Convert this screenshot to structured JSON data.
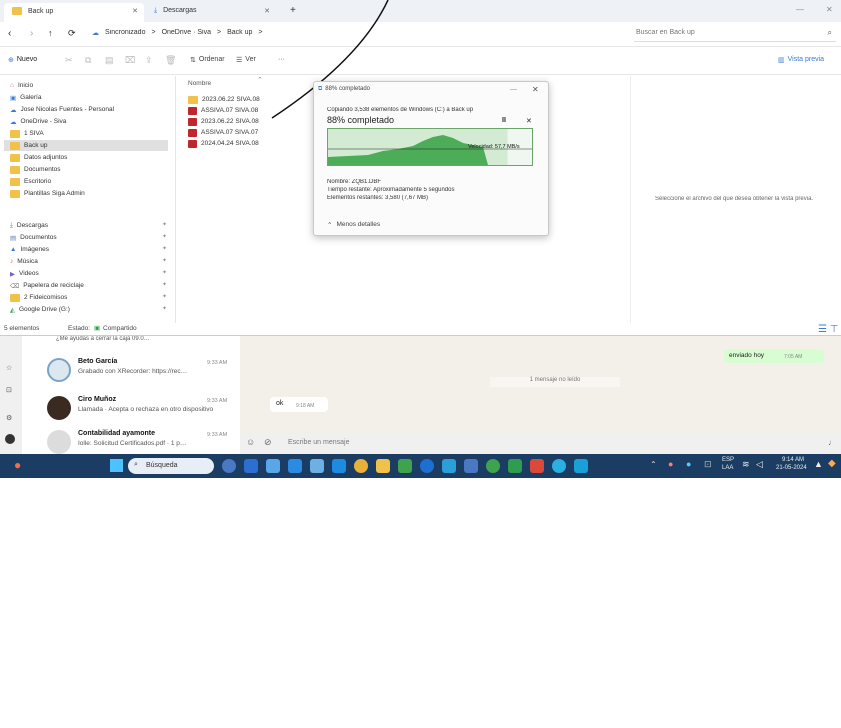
{
  "explorer": {
    "tabs": [
      {
        "label": "Back up"
      },
      {
        "label": "Descargas"
      }
    ],
    "new_tab": "+",
    "window_controls": {
      "minimize": "—",
      "close": "✕"
    },
    "address": {
      "nav_back": "‹",
      "nav_forward": "›",
      "nav_up": "↑",
      "refresh": "⟳",
      "crumbs": [
        "Sincronizado",
        ">",
        "OneDrive · Siva",
        ">",
        "Back up",
        ">"
      ],
      "search_placeholder": "Buscar en Back up",
      "search_icon": "search-icon"
    },
    "commands": {
      "new": "Nuevo",
      "sort": "Ordenar",
      "view": "Ver",
      "more": "···",
      "details": "Vista previa"
    },
    "nav_items": [
      {
        "label": "Inicio",
        "icon": "home-icon"
      },
      {
        "label": "Galería",
        "icon": "gallery-icon"
      },
      {
        "label": "Jose Nicolas Fuentes - Personal",
        "icon": "cloud-icon"
      },
      {
        "label": "OneDrive - Siva",
        "icon": "cloud-icon"
      },
      {
        "label": "1 SIVA",
        "icon": "folder-icon"
      },
      {
        "label": "Back up",
        "icon": "folder-icon"
      },
      {
        "label": "Datos adjuntos",
        "icon": "folder-icon"
      },
      {
        "label": "Documentos",
        "icon": "folder-icon"
      },
      {
        "label": "Escritorio",
        "icon": "folder-icon"
      },
      {
        "label": "Plantillas Siga Admin",
        "icon": "folder-icon"
      },
      {
        "label": "Descargas",
        "icon": "download-icon"
      },
      {
        "label": "Documentos",
        "icon": "document-icon"
      },
      {
        "label": "Imágenes",
        "icon": "image-icon"
      },
      {
        "label": "Música",
        "icon": "music-icon"
      },
      {
        "label": "Videos",
        "icon": "video-icon"
      },
      {
        "label": "Papelera de reciclaje",
        "icon": "trash-icon"
      },
      {
        "label": "2 Fideicomisos",
        "icon": "folder-icon"
      },
      {
        "label": "Google Drive (G:)",
        "icon": "drive-icon"
      }
    ],
    "file_header": "Nombre",
    "files": [
      {
        "name": "2023.06.22 SIVA.08",
        "icon": "folder-icon"
      },
      {
        "name": "ASSIVA.07 SIVA.08",
        "icon": "archive-icon"
      },
      {
        "name": "2023.06.22 SIVA.08",
        "icon": "archive-icon"
      },
      {
        "name": "ASSIVA.07 SIVA.07",
        "icon": "archive-icon"
      },
      {
        "name": "2024.04.24 SIVA.08",
        "icon": "archive-icon"
      }
    ],
    "preview_hint": "Seleccione el archivo del que desea obtener la vista previa.",
    "status": {
      "items": "5 elementos",
      "state": "Estado:",
      "state_value": "Compartido"
    }
  },
  "copy_dialog": {
    "title": "88% completado",
    "line": "Copiando 3,538 elementos de Windows (C:) a Back up",
    "percent": "88% completado",
    "pause": "II",
    "cancel": "✕",
    "speed": "Velocidad: 57,7 MB/s",
    "name": "Nombre: ZQB1.DBF",
    "time_left": "Tiempo restante: Aproximadamente 5 segundos",
    "remaining": "Elementos restantes: 3,580 (7,67 MB)",
    "less_details": "Menos detalles",
    "progress": 0.88
  },
  "whatsapp": {
    "chats": [
      {
        "name": "Beto García",
        "msg": "Grabado con XRecorder: https://rec…",
        "time": "9:33 AM"
      },
      {
        "name": "Ciro Muñoz",
        "msg": "Llamada · Acepta o rechaza en otro dispositivo",
        "time": "9:33 AM"
      },
      {
        "name": "Contabilidad ayamonte",
        "msg": "Iolle: Solicitud Certificados.pdf · 1 p…",
        "time": "9:33 AM"
      }
    ],
    "top_msg": "¿Me ayudas a cerrar la caja 09.0…",
    "sent_bubble": "enviado hoy",
    "sent_time": "7:05 AM",
    "unread_note": "1 mensaje no leído",
    "ok_bubble": "ok",
    "ok_time": "9:18 AM",
    "input_placeholder": "Escribe un mensaje"
  },
  "taskbar": {
    "search": "Búsqueda",
    "lang": "ESP",
    "lang2": "LAA",
    "time": "9:14 AM",
    "date": "21-05-2024"
  }
}
